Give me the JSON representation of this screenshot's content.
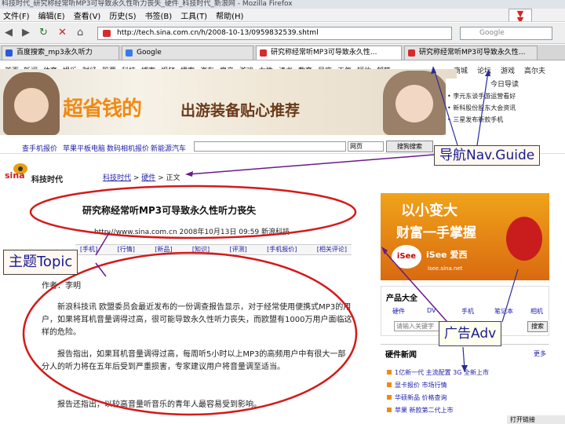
{
  "browser": {
    "title": "科技时代_研究称经常听MP3可导致永久性听力丧失_硬件_科技时代_新浪网 - Mozilla Firefox",
    "menu": [
      "文件(F)",
      "编辑(E)",
      "查看(V)",
      "历史(S)",
      "书签(B)",
      "工具(T)",
      "帮助(H)"
    ],
    "url": "http://tech.sina.com.cn/h/2008-10-13/0959832539.shtml",
    "search_placeholder": "Google",
    "tabs": [
      "百度搜索_mp3永久听力",
      "Google",
      "研究称经常听MP3可导致永久性...",
      "研究称经常听MP3可导致永久性..."
    ]
  },
  "channels": [
    "首页",
    "新闻",
    "体育",
    "娱乐",
    "财经",
    "股票",
    "科技",
    "博客",
    "视频",
    "播客",
    "汽车",
    "房产",
    "游戏",
    "女性",
    "读书",
    "教育",
    "星座",
    "天气",
    "短信",
    "邮箱",
    "商城",
    "论坛",
    "游戏",
    "高尔夫"
  ],
  "banner": {
    "title": "超省钱的",
    "subtitle": "出游装备贴心推荐"
  },
  "toc": {
    "heading": "今日导读",
    "items": [
      "• 李元东谈手游运营看好",
      "• 新科股份股东大会资讯",
      "• 三星发布新款手机"
    ]
  },
  "searchrow": {
    "links": [
      "查手机报价",
      "苹果平板电脑",
      "数码相机报价",
      "新能源汽车"
    ],
    "select": "网页",
    "button": "搜狗搜索"
  },
  "sina": {
    "channel": "科技时代",
    "breadcrumb": [
      "科技时代",
      "硬件",
      "正文"
    ]
  },
  "article": {
    "headline": "研究称经常听MP3可导致永久性听力丧失",
    "meta": "http://www.sina.com.cn  2008年10月13日 09:59  新浪科技",
    "tags": [
      "[手机]",
      "[行情]",
      "[新品]",
      "[知识]",
      "[评测]",
      "[手机报价]",
      "[相关评论]"
    ],
    "author": "作者：李明",
    "paragraphs": [
      "新浪科技讯 欧盟委员会最近发布的一份调查报告显示，对于经常使用便携式MP3的用户，如果将耳机音量调得过高，很可能导致永久性听力丧失，而欧盟有1000万用户面临这样的危险。",
      "报告指出，如果耳机音量调得过高，每周听5小时以上MP3的高频用户中有很大一部分人的听力将在五年后受到严重损害，专家建议用户将音量调至适当。",
      "报告还指出，以较高音量听音乐的青年人最容易受到影响。"
    ]
  },
  "ad": {
    "line1": "以小变大",
    "line2": "财富一手掌握",
    "logo": "iSee 爱西",
    "url": "isee.sina.net"
  },
  "products": {
    "heading": "产品大全",
    "cats": [
      "硬件",
      "DV",
      "手机",
      "笔记本",
      "相机"
    ],
    "input_placeholder": "请输入关键字",
    "button": "搜索"
  },
  "hardware": {
    "heading": "硬件新闻",
    "more": "更多",
    "items": [
      "1亿新一代 主流配置 3G 全新上市",
      "显卡报价 市场行情",
      "华硕新品 价格查询",
      "苹果 新款第二代上市"
    ]
  },
  "status": "打开链接",
  "annotations": {
    "nav": "导航Nav.Guide",
    "topic": "主题Topic",
    "ad": "广告Adv"
  }
}
